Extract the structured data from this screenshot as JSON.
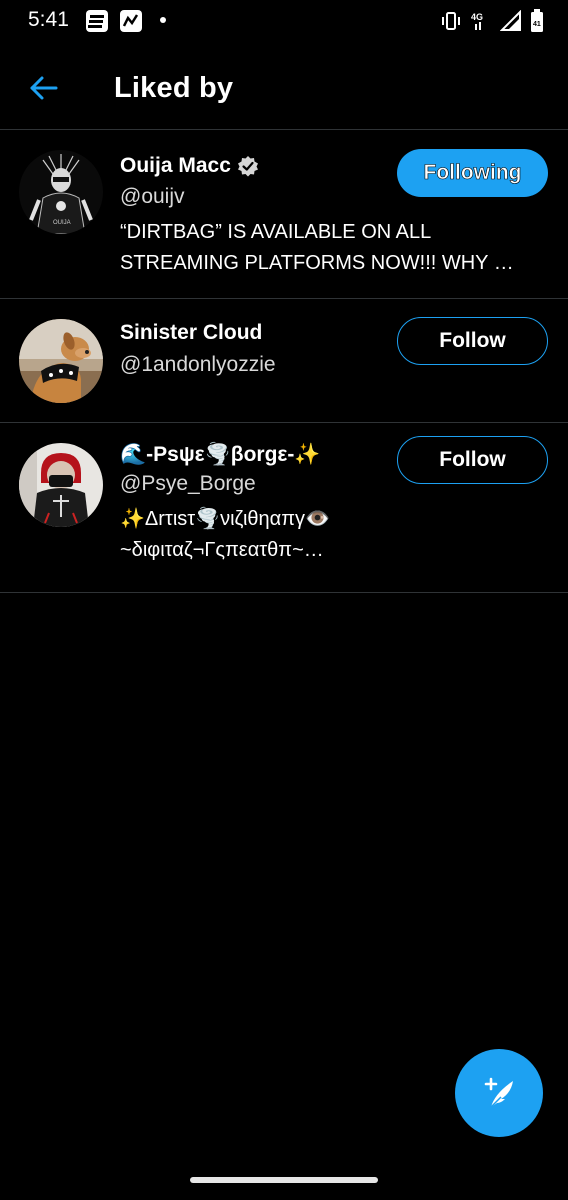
{
  "status_bar": {
    "time": "5:41",
    "icons": [
      "espn-app-icon",
      "stocks-app-icon",
      "notification-dot",
      "vibrate-icon",
      "lte-signal-icon",
      "signal-icon",
      "battery-icon"
    ]
  },
  "header": {
    "back_icon": "arrow-left-icon",
    "title": "Liked by"
  },
  "users": [
    {
      "name": "Ouija Macc",
      "verified": true,
      "handle": "@ouijv",
      "bio_lines": [
        "“DIRTBAG” IS AVAILABLE ON ALL",
        "STREAMING PLATFORMS NOW!!! WHY …"
      ],
      "button": "Following"
    },
    {
      "name": "Sinister Cloud",
      "verified": false,
      "handle": "@1andonlyozzie",
      "bio_lines": [],
      "button": "Follow"
    },
    {
      "name": "🌊-Psψε🌪️βorgε-✨",
      "verified": false,
      "handle": "@Psye_Borge",
      "bio_lines": [
        "✨Δrτιsτ🌪️νιζιθηαπγ👁️",
        "~διφιταζ¬Γςπεατθπ~…"
      ],
      "button": "Follow"
    }
  ],
  "fab": {
    "icon": "compose-tweet-icon"
  },
  "colors": {
    "accent": "#1da1f2",
    "background": "#000000",
    "divider": "#2f3336"
  }
}
